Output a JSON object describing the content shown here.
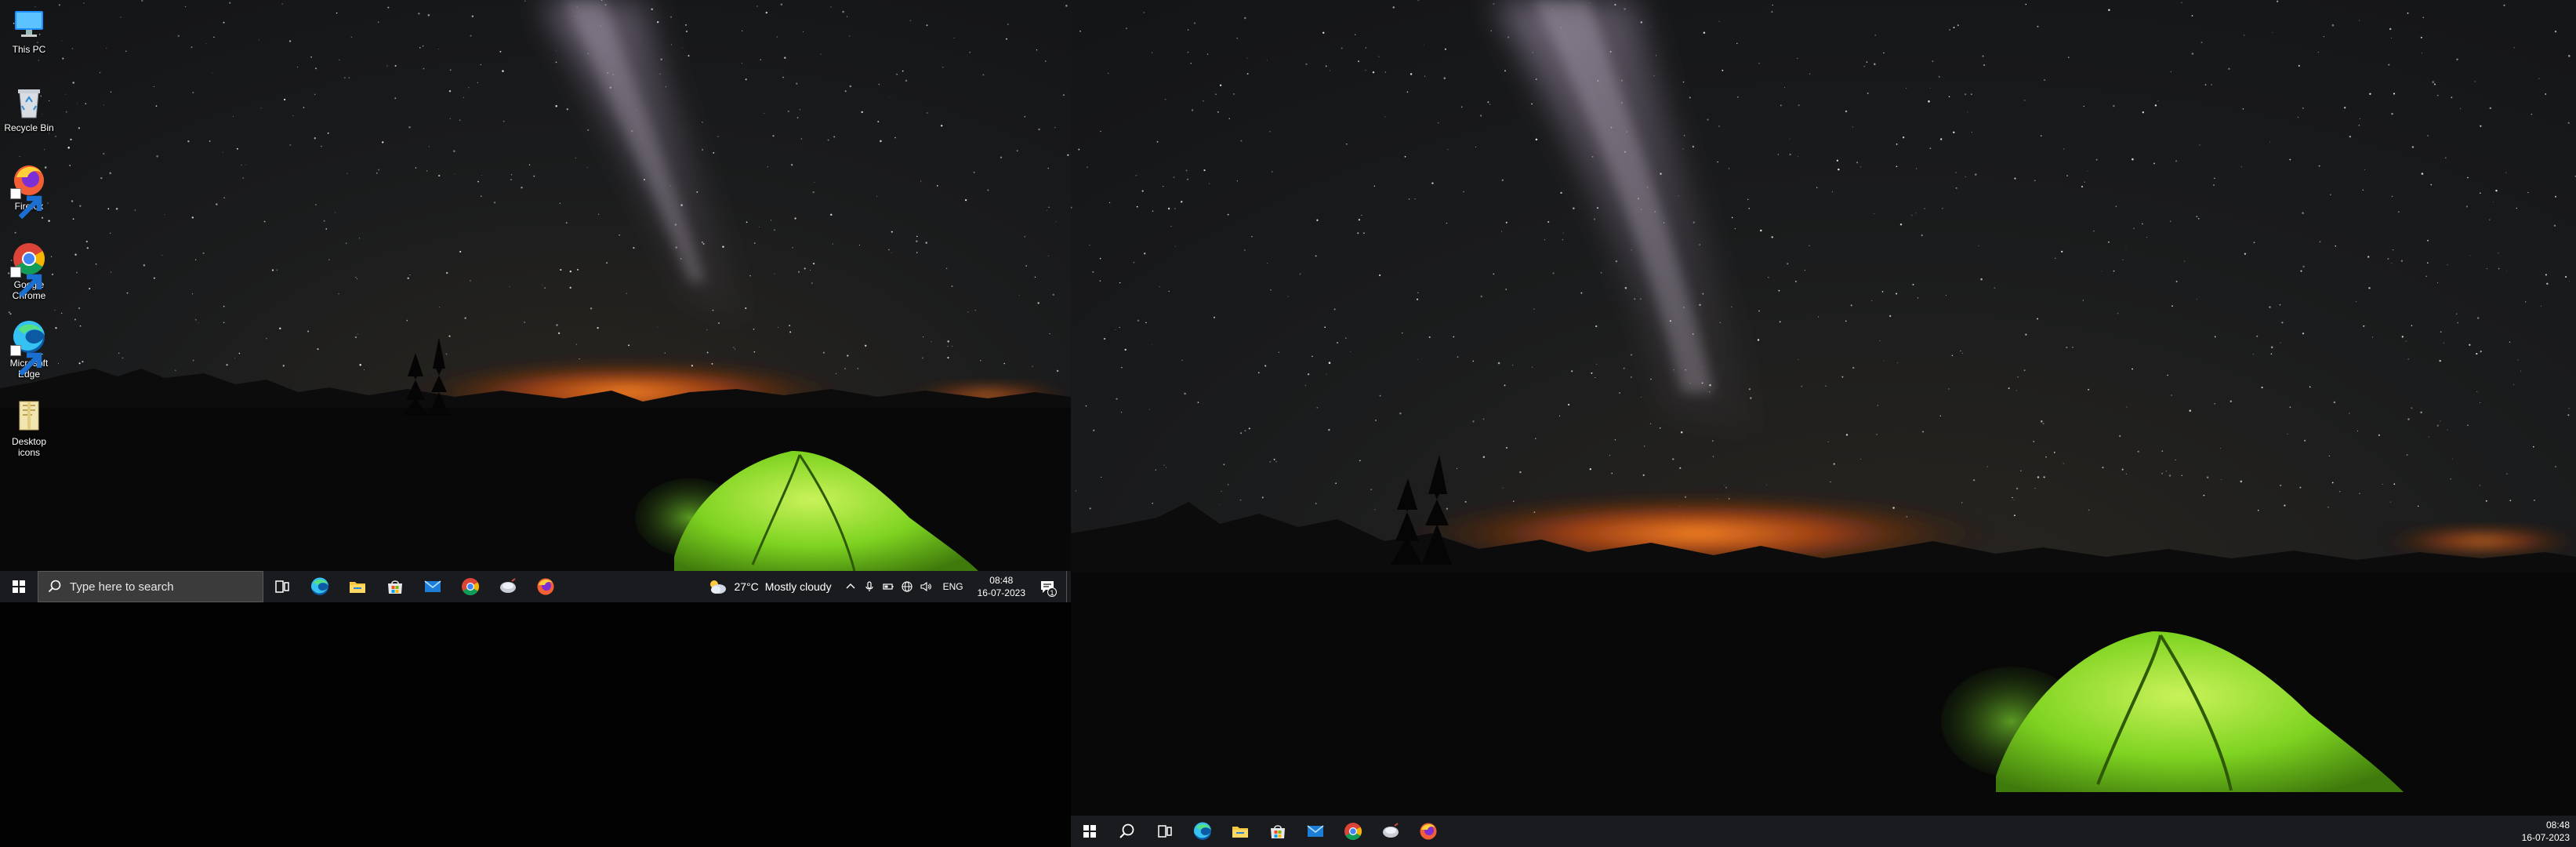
{
  "desktop": {
    "icons": [
      {
        "label": "This PC"
      },
      {
        "label": "Recycle Bin"
      },
      {
        "label": "Firefox"
      },
      {
        "label": "Google Chrome"
      },
      {
        "label": "Microsoft Edge"
      },
      {
        "label": "Desktop icons"
      }
    ]
  },
  "taskbar_left": {
    "search_placeholder": "Here to search",
    "search_placeholder_full": "Type here to search",
    "pinned_apps": [
      "task-view-icon",
      "edge-icon",
      "file-explorer-icon",
      "microsoft-store-icon",
      "mail-icon",
      "chrome-icon",
      "cleanup-tool-icon",
      "firefox-icon"
    ],
    "weather": {
      "temperature": "27°C",
      "condition": "Mostly cloudy"
    },
    "language": "ENG",
    "time": "08:48",
    "date": "16-07-2023",
    "notification_count": "1"
  },
  "taskbar_right": {
    "pinned_apps": [
      "search-icon",
      "task-view-icon",
      "edge-icon",
      "file-explorer-icon",
      "microsoft-store-icon",
      "mail-icon",
      "chrome-icon",
      "cleanup-tool-icon",
      "firefox-icon"
    ],
    "time": "08:48",
    "date": "16-07-2023"
  },
  "colors": {
    "taskbar": "#1a1b1e",
    "search_box": "#3b3b3b",
    "tent": "#7ed321",
    "horizon_glow": "#ff7a1a",
    "sky": "#17191c"
  }
}
